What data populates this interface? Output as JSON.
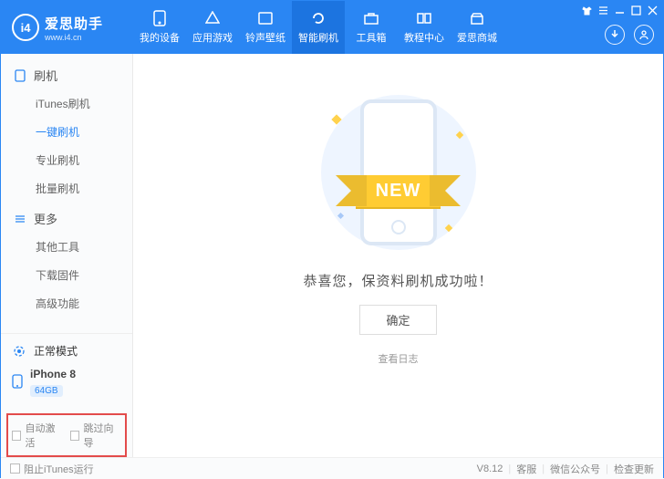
{
  "header": {
    "app_name": "爱思助手",
    "url": "www.i4.cn",
    "logo_text": "i4",
    "nav": [
      {
        "id": "my-devices",
        "label": "我的设备"
      },
      {
        "id": "app-games",
        "label": "应用游戏"
      },
      {
        "id": "ring-wall",
        "label": "铃声壁纸"
      },
      {
        "id": "smart-flash",
        "label": "智能刷机"
      },
      {
        "id": "toolbox",
        "label": "工具箱"
      },
      {
        "id": "tutorial",
        "label": "教程中心"
      },
      {
        "id": "store",
        "label": "爱思商城"
      }
    ],
    "active_nav": 3
  },
  "sidebar": {
    "section_flash": "刷机",
    "items_flash": [
      {
        "label": "iTunes刷机"
      },
      {
        "label": "一键刷机"
      },
      {
        "label": "专业刷机"
      },
      {
        "label": "批量刷机"
      }
    ],
    "active_flash": 1,
    "section_more": "更多",
    "items_more": [
      {
        "label": "其他工具"
      },
      {
        "label": "下载固件"
      },
      {
        "label": "高级功能"
      }
    ],
    "mode_label": "正常模式",
    "device_name": "iPhone 8",
    "device_storage": "64GB",
    "chk_auto_activate": "自动激活",
    "chk_skip_guide": "跳过向导"
  },
  "main": {
    "ribbon_text": "NEW",
    "message": "恭喜您，保资料刷机成功啦！",
    "ok_button": "确定",
    "log_link": "查看日志"
  },
  "footer": {
    "block_itunes": "阻止iTunes运行",
    "version": "V8.12",
    "support": "客服",
    "wechat": "微信公众号",
    "check_update": "检查更新"
  }
}
